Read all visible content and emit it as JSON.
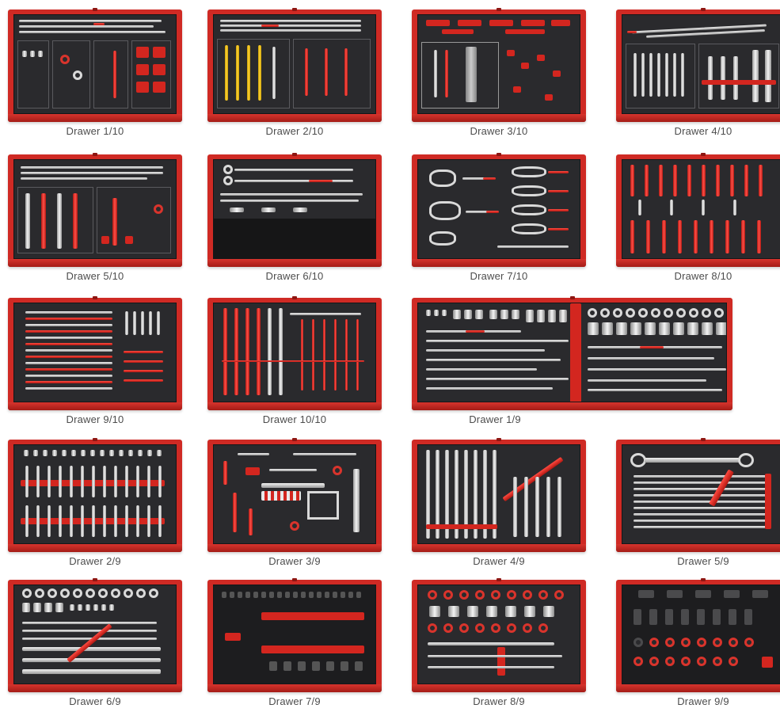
{
  "drawers": [
    {
      "label": "Drawer 1/10"
    },
    {
      "label": "Drawer 2/10"
    },
    {
      "label": "Drawer 3/10"
    },
    {
      "label": "Drawer 4/10"
    },
    {
      "label": "Drawer 5/10"
    },
    {
      "label": "Drawer 6/10"
    },
    {
      "label": "Drawer 7/10"
    },
    {
      "label": "Drawer 8/10"
    },
    {
      "label": "Drawer 9/10"
    },
    {
      "label": "Drawer 10/10"
    },
    {
      "label": "Drawer 1/9"
    },
    {
      "label": "Drawer 2/9"
    },
    {
      "label": "Drawer 3/9"
    },
    {
      "label": "Drawer 4/9"
    },
    {
      "label": "Drawer 5/9"
    },
    {
      "label": "Drawer 6/9"
    },
    {
      "label": "Drawer 7/9"
    },
    {
      "label": "Drawer 8/9"
    },
    {
      "label": "Drawer 9/9"
    }
  ],
  "colors": {
    "drawer_red": "#cf2a24",
    "foam": "#2a2a2d",
    "label_text": "#4d4d4d",
    "background": "#ffffff"
  }
}
